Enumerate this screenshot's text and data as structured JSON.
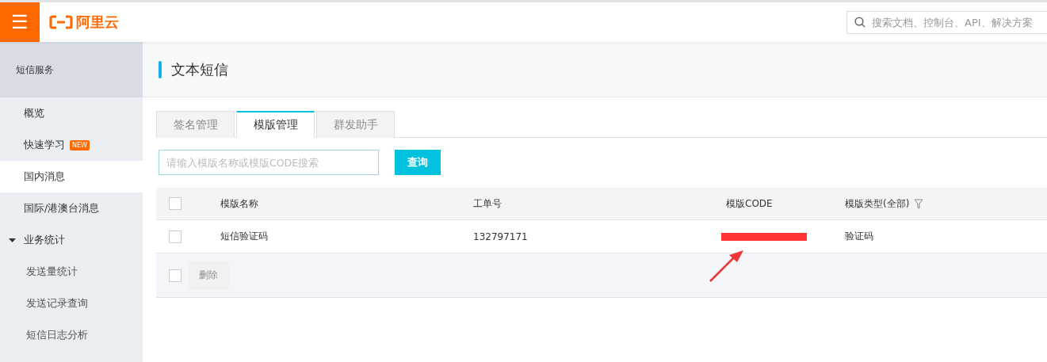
{
  "topbar": {
    "menu_icon": "☰",
    "logo_text": "阿里云",
    "search": {
      "placeholder": "搜索文档、控制台、API、解决方案"
    }
  },
  "sidebar": {
    "title": "短信服务",
    "items": [
      {
        "label": "概览",
        "selected": false
      },
      {
        "label": "快速学习",
        "badge": "NEW",
        "selected": false
      },
      {
        "label": "国内消息",
        "selected": true
      },
      {
        "label": "国际/港澳台消息",
        "selected": false
      },
      {
        "label": "业务统计",
        "selected": false,
        "expanded": true,
        "children": [
          {
            "label": "发送量统计",
            "selected": false
          },
          {
            "label": "发送记录查询",
            "selected": false
          },
          {
            "label": "短信日志分析",
            "selected": false
          }
        ]
      }
    ]
  },
  "page": {
    "title": "文本短信"
  },
  "tabs": [
    {
      "label": "签名管理",
      "selected": false
    },
    {
      "label": "模版管理",
      "selected": true
    },
    {
      "label": "群发助手",
      "selected": false
    }
  ],
  "search": {
    "placeholder": "请输入模版名称或模版CODE搜索",
    "button": "查询"
  },
  "table": {
    "header_checked": false,
    "columns": [
      {
        "label": "模版名称"
      },
      {
        "label": "工单号"
      },
      {
        "label": "模版CODE"
      },
      {
        "label": "模版类型(全部)",
        "filter": true
      }
    ],
    "rows": [
      {
        "checked": false,
        "name": "短信验证码",
        "ticket": "132797171",
        "code_redacted": true,
        "type": "验证码"
      }
    ],
    "footer": {
      "checked": false,
      "delete_button": "删除",
      "delete_disabled": true
    }
  }
}
